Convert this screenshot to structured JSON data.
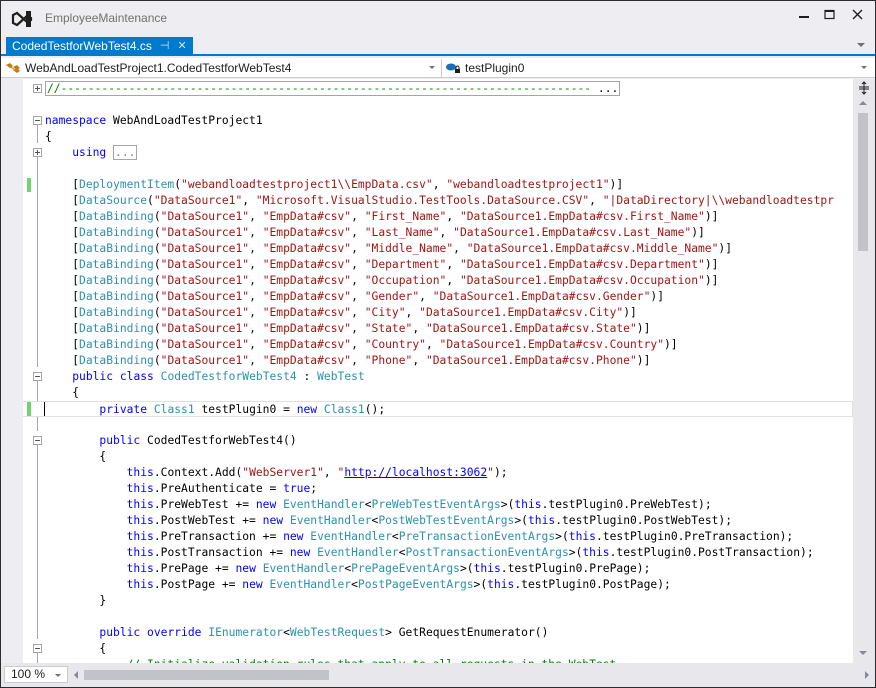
{
  "window": {
    "title": "EmployeeMaintenance",
    "logo_icon": "visual-studio-logo-icon",
    "controls": [
      "minimize",
      "maximize",
      "close"
    ]
  },
  "tabs": [
    {
      "label": "CodedTestforWebTest4.cs",
      "active": true,
      "pin_icon": "pin-icon",
      "close_icon": "close-icon"
    }
  ],
  "navigation": {
    "type_dropdown": {
      "icon": "class-icon",
      "value": "WebAndLoadTestProject1.CodedTestforWebTest4"
    },
    "member_dropdown": {
      "icon": "private-field-icon",
      "value": "testPlugin0"
    }
  },
  "editor": {
    "accent_color": "#007acc",
    "syntax_colors": {
      "keyword": "#0000ff",
      "type": "#2b91af",
      "string": "#a31515",
      "comment": "#008000"
    },
    "lines": [
      {
        "segments": [
          [
            "cm",
            "//------------------------------------------------------------------------------"
          ],
          [
            "pl",
            " ..."
          ]
        ],
        "collapsed": true
      },
      {
        "segments": []
      },
      {
        "segments": [
          [
            "kw",
            "namespace"
          ],
          [
            "pl",
            " WebAndLoadTestProject1"
          ]
        ]
      },
      {
        "segments": [
          [
            "pl",
            "{"
          ]
        ]
      },
      {
        "segments": [
          [
            "pl",
            "    "
          ],
          [
            "kw",
            "using"
          ],
          [
            "pl",
            " "
          ],
          [
            "box",
            "..."
          ]
        ]
      },
      {
        "segments": []
      },
      {
        "segments": [
          [
            "pl",
            "    ["
          ],
          [
            "ty",
            "DeploymentItem"
          ],
          [
            "pl",
            "("
          ],
          [
            "st",
            "\"webandloadtestproject1\\\\EmpData.csv\""
          ],
          [
            "pl",
            ", "
          ],
          [
            "st",
            "\"webandloadtestproject1\""
          ],
          [
            "pl",
            ")]"
          ]
        ]
      },
      {
        "segments": [
          [
            "pl",
            "    ["
          ],
          [
            "ty",
            "DataSource"
          ],
          [
            "pl",
            "("
          ],
          [
            "st",
            "\"DataSource1\""
          ],
          [
            "pl",
            ", "
          ],
          [
            "st",
            "\"Microsoft.VisualStudio.TestTools.DataSource.CSV\""
          ],
          [
            "pl",
            ", "
          ],
          [
            "st",
            "\"|DataDirectory|\\\\webandloadtestpr"
          ]
        ]
      },
      {
        "segments": [
          [
            "pl",
            "    ["
          ],
          [
            "ty",
            "DataBinding"
          ],
          [
            "pl",
            "("
          ],
          [
            "st",
            "\"DataSource1\""
          ],
          [
            "pl",
            ", "
          ],
          [
            "st",
            "\"EmpData#csv\""
          ],
          [
            "pl",
            ", "
          ],
          [
            "st",
            "\"First_Name\""
          ],
          [
            "pl",
            ", "
          ],
          [
            "st",
            "\"DataSource1.EmpData#csv.First_Name\""
          ],
          [
            "pl",
            ")]"
          ]
        ]
      },
      {
        "segments": [
          [
            "pl",
            "    ["
          ],
          [
            "ty",
            "DataBinding"
          ],
          [
            "pl",
            "("
          ],
          [
            "st",
            "\"DataSource1\""
          ],
          [
            "pl",
            ", "
          ],
          [
            "st",
            "\"EmpData#csv\""
          ],
          [
            "pl",
            ", "
          ],
          [
            "st",
            "\"Last_Name\""
          ],
          [
            "pl",
            ", "
          ],
          [
            "st",
            "\"DataSource1.EmpData#csv.Last_Name\""
          ],
          [
            "pl",
            ")]"
          ]
        ]
      },
      {
        "segments": [
          [
            "pl",
            "    ["
          ],
          [
            "ty",
            "DataBinding"
          ],
          [
            "pl",
            "("
          ],
          [
            "st",
            "\"DataSource1\""
          ],
          [
            "pl",
            ", "
          ],
          [
            "st",
            "\"EmpData#csv\""
          ],
          [
            "pl",
            ", "
          ],
          [
            "st",
            "\"Middle_Name\""
          ],
          [
            "pl",
            ", "
          ],
          [
            "st",
            "\"DataSource1.EmpData#csv.Middle_Name\""
          ],
          [
            "pl",
            ")]"
          ]
        ]
      },
      {
        "segments": [
          [
            "pl",
            "    ["
          ],
          [
            "ty",
            "DataBinding"
          ],
          [
            "pl",
            "("
          ],
          [
            "st",
            "\"DataSource1\""
          ],
          [
            "pl",
            ", "
          ],
          [
            "st",
            "\"EmpData#csv\""
          ],
          [
            "pl",
            ", "
          ],
          [
            "st",
            "\"Department\""
          ],
          [
            "pl",
            ", "
          ],
          [
            "st",
            "\"DataSource1.EmpData#csv.Department\""
          ],
          [
            "pl",
            ")]"
          ]
        ]
      },
      {
        "segments": [
          [
            "pl",
            "    ["
          ],
          [
            "ty",
            "DataBinding"
          ],
          [
            "pl",
            "("
          ],
          [
            "st",
            "\"DataSource1\""
          ],
          [
            "pl",
            ", "
          ],
          [
            "st",
            "\"EmpData#csv\""
          ],
          [
            "pl",
            ", "
          ],
          [
            "st",
            "\"Occupation\""
          ],
          [
            "pl",
            ", "
          ],
          [
            "st",
            "\"DataSource1.EmpData#csv.Occupation\""
          ],
          [
            "pl",
            ")]"
          ]
        ]
      },
      {
        "segments": [
          [
            "pl",
            "    ["
          ],
          [
            "ty",
            "DataBinding"
          ],
          [
            "pl",
            "("
          ],
          [
            "st",
            "\"DataSource1\""
          ],
          [
            "pl",
            ", "
          ],
          [
            "st",
            "\"EmpData#csv\""
          ],
          [
            "pl",
            ", "
          ],
          [
            "st",
            "\"Gender\""
          ],
          [
            "pl",
            ", "
          ],
          [
            "st",
            "\"DataSource1.EmpData#csv.Gender\""
          ],
          [
            "pl",
            ")]"
          ]
        ]
      },
      {
        "segments": [
          [
            "pl",
            "    ["
          ],
          [
            "ty",
            "DataBinding"
          ],
          [
            "pl",
            "("
          ],
          [
            "st",
            "\"DataSource1\""
          ],
          [
            "pl",
            ", "
          ],
          [
            "st",
            "\"EmpData#csv\""
          ],
          [
            "pl",
            ", "
          ],
          [
            "st",
            "\"City\""
          ],
          [
            "pl",
            ", "
          ],
          [
            "st",
            "\"DataSource1.EmpData#csv.City\""
          ],
          [
            "pl",
            ")]"
          ]
        ]
      },
      {
        "segments": [
          [
            "pl",
            "    ["
          ],
          [
            "ty",
            "DataBinding"
          ],
          [
            "pl",
            "("
          ],
          [
            "st",
            "\"DataSource1\""
          ],
          [
            "pl",
            ", "
          ],
          [
            "st",
            "\"EmpData#csv\""
          ],
          [
            "pl",
            ", "
          ],
          [
            "st",
            "\"State\""
          ],
          [
            "pl",
            ", "
          ],
          [
            "st",
            "\"DataSource1.EmpData#csv.State\""
          ],
          [
            "pl",
            ")]"
          ]
        ]
      },
      {
        "segments": [
          [
            "pl",
            "    ["
          ],
          [
            "ty",
            "DataBinding"
          ],
          [
            "pl",
            "("
          ],
          [
            "st",
            "\"DataSource1\""
          ],
          [
            "pl",
            ", "
          ],
          [
            "st",
            "\"EmpData#csv\""
          ],
          [
            "pl",
            ", "
          ],
          [
            "st",
            "\"Country\""
          ],
          [
            "pl",
            ", "
          ],
          [
            "st",
            "\"DataSource1.EmpData#csv.Country\""
          ],
          [
            "pl",
            ")]"
          ]
        ]
      },
      {
        "segments": [
          [
            "pl",
            "    ["
          ],
          [
            "ty",
            "DataBinding"
          ],
          [
            "pl",
            "("
          ],
          [
            "st",
            "\"DataSource1\""
          ],
          [
            "pl",
            ", "
          ],
          [
            "st",
            "\"EmpData#csv\""
          ],
          [
            "pl",
            ", "
          ],
          [
            "st",
            "\"Phone\""
          ],
          [
            "pl",
            ", "
          ],
          [
            "st",
            "\"DataSource1.EmpData#csv.Phone\""
          ],
          [
            "pl",
            ")]"
          ]
        ]
      },
      {
        "segments": [
          [
            "pl",
            "    "
          ],
          [
            "kw",
            "public"
          ],
          [
            "pl",
            " "
          ],
          [
            "kw",
            "class"
          ],
          [
            "pl",
            " "
          ],
          [
            "ty",
            "CodedTestforWebTest4"
          ],
          [
            "pl",
            " : "
          ],
          [
            "ty",
            "WebTest"
          ]
        ]
      },
      {
        "segments": [
          [
            "pl",
            "    {"
          ]
        ]
      },
      {
        "segments": [
          [
            "pl",
            "        "
          ],
          [
            "kw",
            "private"
          ],
          [
            "pl",
            " "
          ],
          [
            "ty",
            "Class1"
          ],
          [
            "pl",
            " testPlugin0 = "
          ],
          [
            "kw",
            "new"
          ],
          [
            "pl",
            " "
          ],
          [
            "ty",
            "Class1"
          ],
          [
            "pl",
            "();"
          ]
        ],
        "current": true
      },
      {
        "segments": []
      },
      {
        "segments": [
          [
            "pl",
            "        "
          ],
          [
            "kw",
            "public"
          ],
          [
            "pl",
            " CodedTestforWebTest4()"
          ]
        ]
      },
      {
        "segments": [
          [
            "pl",
            "        {"
          ]
        ]
      },
      {
        "segments": [
          [
            "pl",
            "            "
          ],
          [
            "kw",
            "this"
          ],
          [
            "pl",
            ".Context.Add("
          ],
          [
            "st",
            "\"WebServer1\""
          ],
          [
            "pl",
            ", "
          ],
          [
            "st",
            "\""
          ],
          [
            "ln",
            "http://localhost:3062"
          ],
          [
            "st",
            "\""
          ],
          [
            "pl",
            ");"
          ]
        ]
      },
      {
        "segments": [
          [
            "pl",
            "            "
          ],
          [
            "kw",
            "this"
          ],
          [
            "pl",
            ".PreAuthenticate = "
          ],
          [
            "kw",
            "true"
          ],
          [
            "pl",
            ";"
          ]
        ]
      },
      {
        "segments": [
          [
            "pl",
            "            "
          ],
          [
            "kw",
            "this"
          ],
          [
            "pl",
            ".PreWebTest += "
          ],
          [
            "kw",
            "new"
          ],
          [
            "pl",
            " "
          ],
          [
            "ty",
            "EventHandler"
          ],
          [
            "pl",
            "<"
          ],
          [
            "ty",
            "PreWebTestEventArgs"
          ],
          [
            "pl",
            ">("
          ],
          [
            "kw",
            "this"
          ],
          [
            "pl",
            ".testPlugin0.PreWebTest);"
          ]
        ]
      },
      {
        "segments": [
          [
            "pl",
            "            "
          ],
          [
            "kw",
            "this"
          ],
          [
            "pl",
            ".PostWebTest += "
          ],
          [
            "kw",
            "new"
          ],
          [
            "pl",
            " "
          ],
          [
            "ty",
            "EventHandler"
          ],
          [
            "pl",
            "<"
          ],
          [
            "ty",
            "PostWebTestEventArgs"
          ],
          [
            "pl",
            ">("
          ],
          [
            "kw",
            "this"
          ],
          [
            "pl",
            ".testPlugin0.PostWebTest);"
          ]
        ]
      },
      {
        "segments": [
          [
            "pl",
            "            "
          ],
          [
            "kw",
            "this"
          ],
          [
            "pl",
            ".PreTransaction += "
          ],
          [
            "kw",
            "new"
          ],
          [
            "pl",
            " "
          ],
          [
            "ty",
            "EventHandler"
          ],
          [
            "pl",
            "<"
          ],
          [
            "ty",
            "PreTransactionEventArgs"
          ],
          [
            "pl",
            ">("
          ],
          [
            "kw",
            "this"
          ],
          [
            "pl",
            ".testPlugin0.PreTransaction);"
          ]
        ]
      },
      {
        "segments": [
          [
            "pl",
            "            "
          ],
          [
            "kw",
            "this"
          ],
          [
            "pl",
            ".PostTransaction += "
          ],
          [
            "kw",
            "new"
          ],
          [
            "pl",
            " "
          ],
          [
            "ty",
            "EventHandler"
          ],
          [
            "pl",
            "<"
          ],
          [
            "ty",
            "PostTransactionEventArgs"
          ],
          [
            "pl",
            ">("
          ],
          [
            "kw",
            "this"
          ],
          [
            "pl",
            ".testPlugin0.PostTransaction);"
          ]
        ]
      },
      {
        "segments": [
          [
            "pl",
            "            "
          ],
          [
            "kw",
            "this"
          ],
          [
            "pl",
            ".PrePage += "
          ],
          [
            "kw",
            "new"
          ],
          [
            "pl",
            " "
          ],
          [
            "ty",
            "EventHandler"
          ],
          [
            "pl",
            "<"
          ],
          [
            "ty",
            "PrePageEventArgs"
          ],
          [
            "pl",
            ">("
          ],
          [
            "kw",
            "this"
          ],
          [
            "pl",
            ".testPlugin0.PrePage);"
          ]
        ]
      },
      {
        "segments": [
          [
            "pl",
            "            "
          ],
          [
            "kw",
            "this"
          ],
          [
            "pl",
            ".PostPage += "
          ],
          [
            "kw",
            "new"
          ],
          [
            "pl",
            " "
          ],
          [
            "ty",
            "EventHandler"
          ],
          [
            "pl",
            "<"
          ],
          [
            "ty",
            "PostPageEventArgs"
          ],
          [
            "pl",
            ">("
          ],
          [
            "kw",
            "this"
          ],
          [
            "pl",
            ".testPlugin0.PostPage);"
          ]
        ]
      },
      {
        "segments": [
          [
            "pl",
            "        }"
          ]
        ]
      },
      {
        "segments": []
      },
      {
        "segments": [
          [
            "pl",
            "        "
          ],
          [
            "kw",
            "public"
          ],
          [
            "pl",
            " "
          ],
          [
            "kw",
            "override"
          ],
          [
            "pl",
            " "
          ],
          [
            "ty",
            "IEnumerator"
          ],
          [
            "pl",
            "<"
          ],
          [
            "ty",
            "WebTestRequest"
          ],
          [
            "pl",
            "> GetRequestEnumerator()"
          ]
        ]
      },
      {
        "segments": [
          [
            "pl",
            "        {"
          ]
        ]
      },
      {
        "segments": [
          [
            "pl",
            "            "
          ],
          [
            "cm",
            "// Initialize validation rules that apply to all requests in the WebTest"
          ]
        ]
      }
    ]
  },
  "statusbar": {
    "zoom_level": "100 %"
  },
  "scroll": {
    "vertical_position_fraction": 0.0,
    "horizontal_position_fraction": 0.0
  }
}
